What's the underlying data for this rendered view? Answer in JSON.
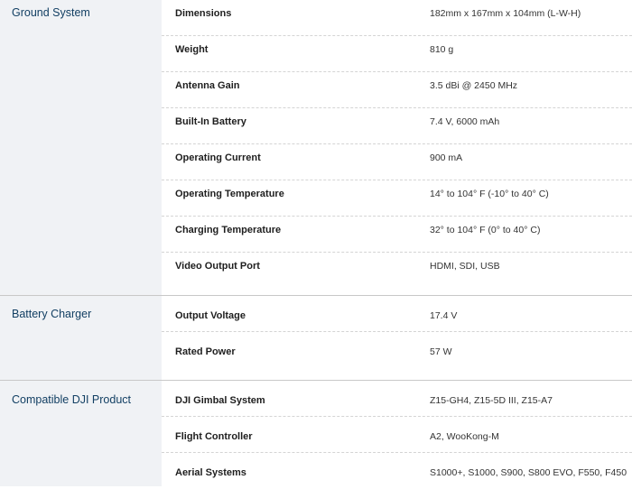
{
  "sections": [
    {
      "title": "Ground System",
      "rows": [
        {
          "label": "Dimensions",
          "value": "182mm x 167mm x 104mm (L-W-H)"
        },
        {
          "label": "Weight",
          "value": "810 g"
        },
        {
          "label": "Antenna Gain",
          "value": "3.5 dBi @ 2450 MHz"
        },
        {
          "label": "Built-In Battery",
          "value": "7.4 V, 6000 mAh"
        },
        {
          "label": "Operating Current",
          "value": "900 mA"
        },
        {
          "label": "Operating Temperature",
          "value": "14° to 104° F (-10° to 40° C)"
        },
        {
          "label": "Charging Temperature",
          "value": "32° to 104° F (0° to 40° C)"
        },
        {
          "label": "Video Output Port",
          "value": "HDMI, SDI, USB"
        }
      ]
    },
    {
      "title": "Battery Charger",
      "rows": [
        {
          "label": "Output Voltage",
          "value": "17.4 V"
        },
        {
          "label": "Rated Power",
          "value": "57 W"
        }
      ]
    },
    {
      "title": "Compatible DJI Product",
      "rows": [
        {
          "label": "DJI Gimbal System",
          "value": "Z15-GH4, Z15-5D III, Z15-A7"
        },
        {
          "label": "Flight Controller",
          "value": "A2, WooKong-M"
        },
        {
          "label": "Aerial Systems",
          "value": "S1000+, S1000, S900, S800 EVO, F550, F450"
        }
      ]
    }
  ]
}
